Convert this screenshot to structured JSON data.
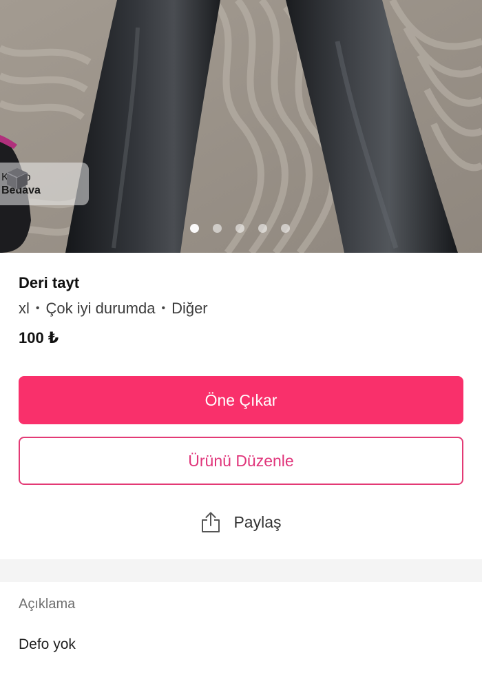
{
  "hero": {
    "photo_description_icon": "leather-pants-photo",
    "carousel_count": 5,
    "carousel_active_index": 0
  },
  "cargo_badge": {
    "icon": "box-icon",
    "line1": "Kargo",
    "line2": "Bedava"
  },
  "product": {
    "title": "Deri tayt",
    "size": "xl",
    "condition": "Çok iyi durumda",
    "brand": "Diğer",
    "separator": "•",
    "price": "100 ₺"
  },
  "actions": {
    "highlight_label": "Öne Çıkar",
    "edit_label": "Ürünü Düzenle",
    "share_label": "Paylaş",
    "share_icon": "share-icon"
  },
  "description": {
    "heading": "Açıklama",
    "body": "Defo yok"
  },
  "colors": {
    "primary": "#f9306b",
    "outline": "#e33a75",
    "band": "#f4f4f4"
  }
}
